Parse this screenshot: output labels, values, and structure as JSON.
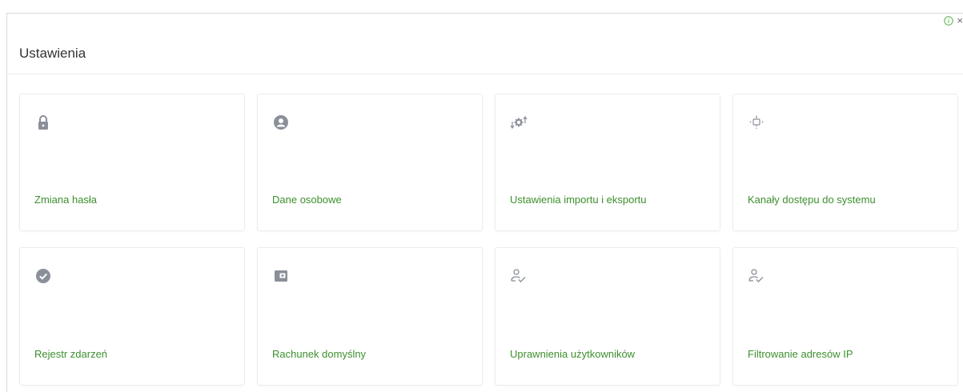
{
  "header": {
    "title": "Ustawienia"
  },
  "ad_controls": {
    "info_icon": "info-circle-icon",
    "close_label": "×"
  },
  "colors": {
    "accent": "#3d8f2e",
    "icon": "#8a8f99",
    "info": "#52b043"
  },
  "tiles": [
    {
      "label": "Zmiana hasła",
      "icon": "lock-icon"
    },
    {
      "label": "Dane osobowe",
      "icon": "user-circle-icon"
    },
    {
      "label": "Ustawienia importu i eksportu",
      "icon": "import-export-gear-icon"
    },
    {
      "label": "Kanały dostępu do systemu",
      "icon": "access-channels-icon"
    },
    {
      "label": "Rejestr zdarzeń",
      "icon": "check-circle-icon"
    },
    {
      "label": "Rachunek domyślny",
      "icon": "wallet-icon"
    },
    {
      "label": "Uprawnienia użytkowników",
      "icon": "user-check-icon"
    },
    {
      "label": "Filtrowanie adresów IP",
      "icon": "user-check-icon"
    }
  ]
}
